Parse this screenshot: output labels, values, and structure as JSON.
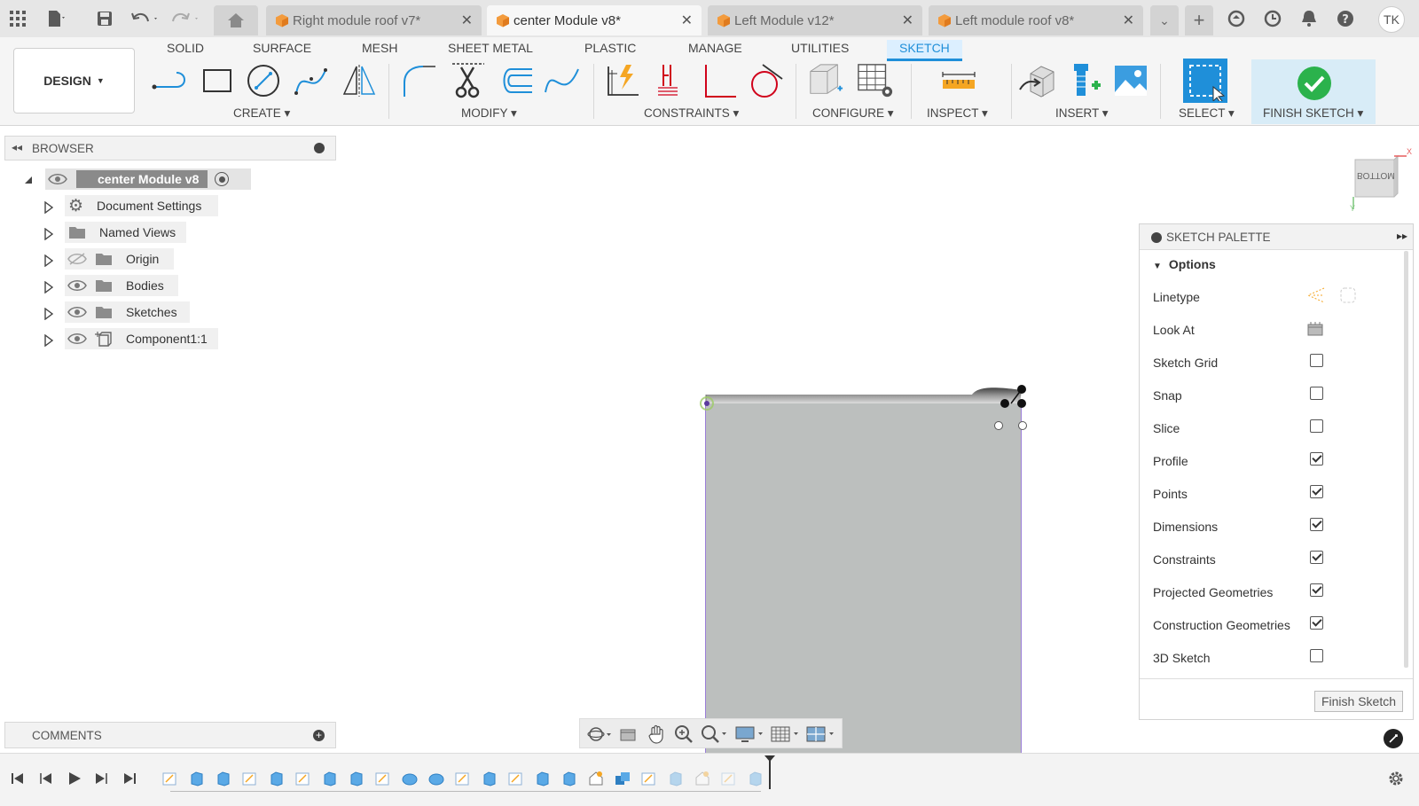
{
  "tabs": [
    {
      "label": "Right module roof v7*",
      "active": false
    },
    {
      "label": "center Module v8*",
      "active": true
    },
    {
      "label": "Left Module v12*",
      "active": false
    },
    {
      "label": "Left module roof v8*",
      "active": false
    }
  ],
  "user": {
    "initials": "TK"
  },
  "ribbon": {
    "tabs": [
      "SOLID",
      "SURFACE",
      "MESH",
      "SHEET METAL",
      "PLASTIC",
      "MANAGE",
      "UTILITIES",
      "SKETCH"
    ],
    "active_tab": "SKETCH",
    "workspace": "DESIGN",
    "groups": {
      "create": "CREATE",
      "modify": "MODIFY",
      "constraints": "CONSTRAINTS",
      "configure": "CONFIGURE",
      "inspect": "INSPECT",
      "insert": "INSERT",
      "select": "SELECT",
      "finish": "FINISH SKETCH"
    }
  },
  "browser": {
    "title": "BROWSER",
    "root": "center Module v8",
    "items": [
      {
        "label": "Document Settings",
        "icon": "gear-icon"
      },
      {
        "label": "Named Views",
        "icon": "folder-icon"
      },
      {
        "label": "Origin",
        "icon": "folder-icon",
        "hidden": true
      },
      {
        "label": "Bodies",
        "icon": "folder-icon"
      },
      {
        "label": "Sketches",
        "icon": "folder-icon"
      },
      {
        "label": "Component1:1",
        "icon": "component-icon"
      }
    ]
  },
  "viewcube": {
    "face": "BOTTOM",
    "axis_x": "X",
    "axis_y": "Y"
  },
  "palette": {
    "title": "SKETCH PALETTE",
    "section": "Options",
    "rows": [
      {
        "label": "Linetype",
        "type": "icons"
      },
      {
        "label": "Look At",
        "type": "icon"
      },
      {
        "label": "Sketch Grid",
        "checked": false
      },
      {
        "label": "Snap",
        "checked": false
      },
      {
        "label": "Slice",
        "checked": false
      },
      {
        "label": "Profile",
        "checked": true
      },
      {
        "label": "Points",
        "checked": true
      },
      {
        "label": "Dimensions",
        "checked": true
      },
      {
        "label": "Constraints",
        "checked": true
      },
      {
        "label": "Projected Geometries",
        "checked": true
      },
      {
        "label": "Construction Geometries",
        "checked": true
      },
      {
        "label": "3D Sketch",
        "checked": false
      }
    ],
    "finish_button": "Finish Sketch"
  },
  "comments": {
    "title": "COMMENTS"
  },
  "colors": {
    "accent": "#1f8fd9",
    "finish_green": "#2bb24c",
    "sketch_fill": "#bcbfbe",
    "profile_line": "#9b7ed9"
  }
}
